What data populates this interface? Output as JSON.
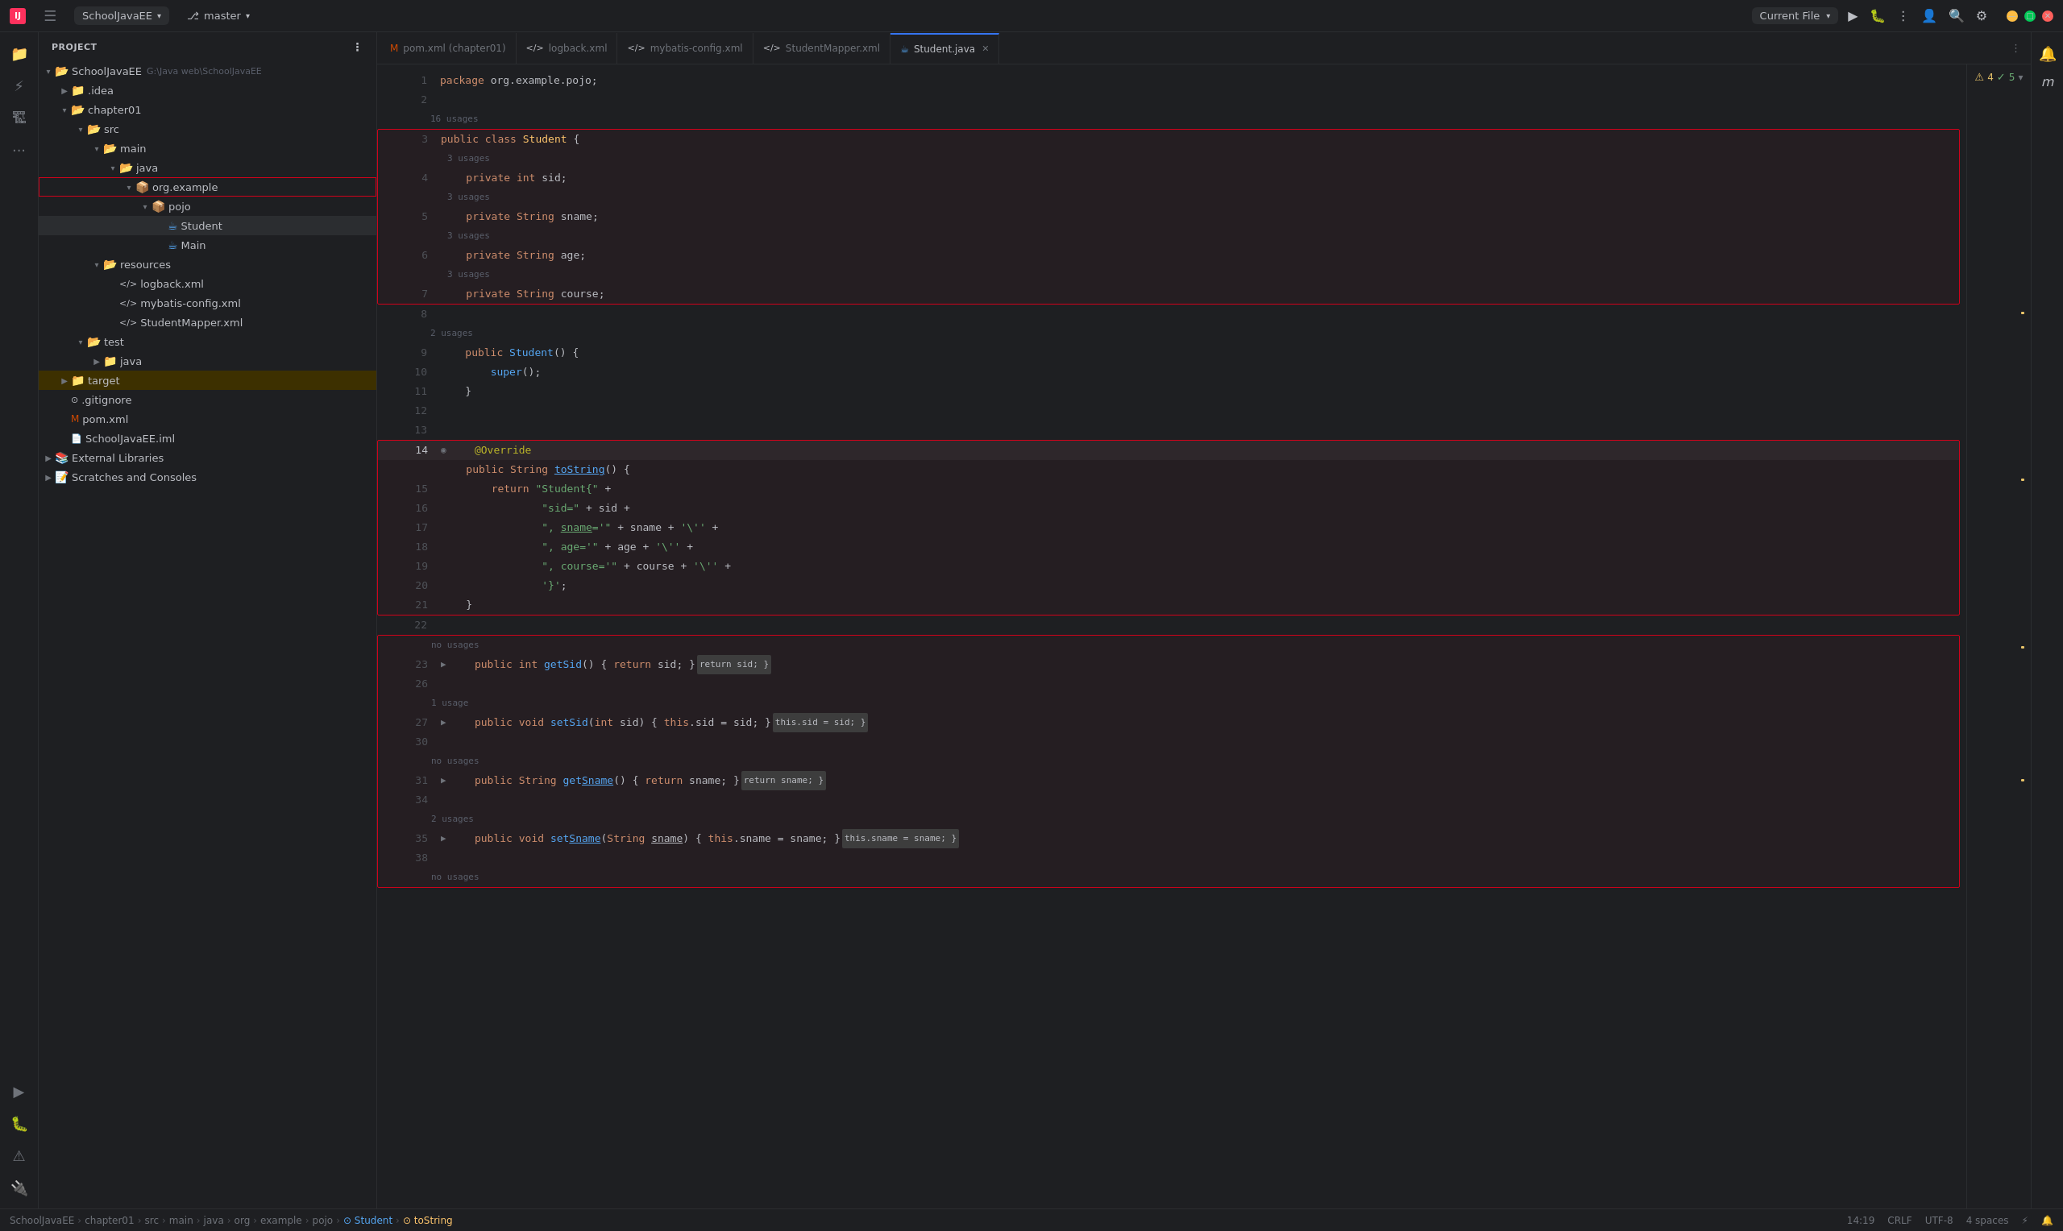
{
  "app": {
    "title": "SchoolJavaEE",
    "branch": "master",
    "logo_text": "IJ"
  },
  "titlebar": {
    "project_label": "SchoolJavaEE",
    "branch_label": "master",
    "run_config": "Current File"
  },
  "sidebar": {
    "header": "Project",
    "tree": [
      {
        "id": "school-root",
        "label": "SchoolJavaEE",
        "path": "G:\\Java web\\SchoolJavaEE",
        "indent": 0,
        "type": "project",
        "expanded": true
      },
      {
        "id": "idea",
        "label": ".idea",
        "indent": 1,
        "type": "folder",
        "expanded": false
      },
      {
        "id": "chapter01",
        "label": "chapter01",
        "indent": 1,
        "type": "folder",
        "expanded": true
      },
      {
        "id": "src",
        "label": "src",
        "indent": 2,
        "type": "folder",
        "expanded": true
      },
      {
        "id": "main",
        "label": "main",
        "indent": 3,
        "type": "folder",
        "expanded": true
      },
      {
        "id": "java",
        "label": "java",
        "indent": 4,
        "type": "folder",
        "expanded": true
      },
      {
        "id": "org-example",
        "label": "org.example",
        "indent": 5,
        "type": "package",
        "expanded": true,
        "highlighted": true
      },
      {
        "id": "pojo",
        "label": "pojo",
        "indent": 6,
        "type": "package",
        "expanded": true
      },
      {
        "id": "student",
        "label": "Student",
        "indent": 7,
        "type": "java",
        "selected": true
      },
      {
        "id": "main-class",
        "label": "Main",
        "indent": 7,
        "type": "java"
      },
      {
        "id": "resources",
        "label": "resources",
        "indent": 3,
        "type": "folder",
        "expanded": true
      },
      {
        "id": "logback-xml",
        "label": "logback.xml",
        "indent": 4,
        "type": "xml"
      },
      {
        "id": "mybatis-config",
        "label": "mybatis-config.xml",
        "indent": 4,
        "type": "xml"
      },
      {
        "id": "student-mapper",
        "label": "StudentMapper.xml",
        "indent": 4,
        "type": "xml"
      },
      {
        "id": "test",
        "label": "test",
        "indent": 2,
        "type": "folder",
        "expanded": true
      },
      {
        "id": "test-java",
        "label": "java",
        "indent": 3,
        "type": "folder",
        "expanded": false
      },
      {
        "id": "target",
        "label": "target",
        "indent": 1,
        "type": "folder",
        "expanded": false,
        "highlighted_row": true
      },
      {
        "id": "gitignore",
        "label": ".gitignore",
        "indent": 1,
        "type": "file"
      },
      {
        "id": "pom-xml",
        "label": "pom.xml",
        "indent": 1,
        "type": "maven"
      },
      {
        "id": "school-iml",
        "label": "SchoolJavaEE.iml",
        "indent": 1,
        "type": "file"
      },
      {
        "id": "ext-libs",
        "label": "External Libraries",
        "indent": 0,
        "type": "libs",
        "expanded": false
      },
      {
        "id": "scratches",
        "label": "Scratches and Consoles",
        "indent": 0,
        "type": "scratches",
        "expanded": false
      }
    ]
  },
  "tabs": [
    {
      "id": "pom",
      "label": "pom.xml (chapter01)",
      "type": "maven",
      "active": false
    },
    {
      "id": "logback",
      "label": "logback.xml",
      "type": "xml",
      "active": false
    },
    {
      "id": "mybatis",
      "label": "mybatis-config.xml",
      "type": "xml",
      "active": false
    },
    {
      "id": "mapper",
      "label": "StudentMapper.xml",
      "type": "xml",
      "active": false
    },
    {
      "id": "student",
      "label": "Student.java",
      "type": "java",
      "active": true
    }
  ],
  "editor": {
    "filename": "Student.java",
    "lines": [
      {
        "num": 1,
        "code": "package org.example.pojo;"
      },
      {
        "num": 2,
        "code": ""
      },
      {
        "num": "",
        "code": "16 usages",
        "type": "usage"
      },
      {
        "num": 3,
        "code": "public class Student {"
      },
      {
        "num": "",
        "code": "3 usages",
        "type": "usage"
      },
      {
        "num": 4,
        "code": "    private int sid;"
      },
      {
        "num": "",
        "code": "3 usages",
        "type": "usage"
      },
      {
        "num": 5,
        "code": "    private String sname;"
      },
      {
        "num": "",
        "code": "3 usages",
        "type": "usage"
      },
      {
        "num": 6,
        "code": "    private String age;"
      },
      {
        "num": "",
        "code": "3 usages",
        "type": "usage"
      },
      {
        "num": 7,
        "code": "    private String course;"
      },
      {
        "num": 8,
        "code": ""
      },
      {
        "num": "",
        "code": "2 usages",
        "type": "usage"
      },
      {
        "num": 9,
        "code": "    public Student() {"
      },
      {
        "num": 10,
        "code": "        super();"
      },
      {
        "num": 11,
        "code": "    }"
      },
      {
        "num": 12,
        "code": ""
      },
      {
        "num": 13,
        "code": ""
      },
      {
        "num": 14,
        "code": "    @Override"
      },
      {
        "num": "",
        "code": "public String toString() {",
        "type": "tostring"
      },
      {
        "num": 15,
        "code": "        return \"Student{\" +"
      },
      {
        "num": 16,
        "code": "                \"sid=\" + sid +"
      },
      {
        "num": 17,
        "code": "                \", sname='\" + sname + '\\'\\'' +"
      },
      {
        "num": 18,
        "code": "                \", age='\" + age + '\\'\\'' +"
      },
      {
        "num": 19,
        "code": "                \", course='\" + course + '\\'\\'' +"
      },
      {
        "num": 20,
        "code": "                '}';"
      },
      {
        "num": 21,
        "code": "    }"
      },
      {
        "num": 22,
        "code": ""
      },
      {
        "num": "",
        "code": "no usages",
        "type": "usage"
      },
      {
        "num": 23,
        "code": "    public int getSid() { return sid; }"
      },
      {
        "num": 26,
        "code": ""
      },
      {
        "num": "",
        "code": "1 usage",
        "type": "usage"
      },
      {
        "num": 27,
        "code": "    public void setSid(int sid) { this.sid = sid; }"
      },
      {
        "num": 30,
        "code": ""
      },
      {
        "num": "",
        "code": "no usages",
        "type": "usage"
      },
      {
        "num": 31,
        "code": "    public String getSname() { return sname; }"
      },
      {
        "num": 34,
        "code": ""
      },
      {
        "num": "",
        "code": "2 usages",
        "type": "usage"
      },
      {
        "num": 35,
        "code": "    public void setSname(String sname) { this.sname = sname; }"
      },
      {
        "num": 38,
        "code": ""
      },
      {
        "num": "",
        "code": "no usages",
        "type": "usage"
      }
    ]
  },
  "statusbar": {
    "breadcrumb": [
      "SchoolJavaEE",
      "chapter01",
      "src",
      "main",
      "java",
      "org",
      "example",
      "pojo",
      "Student",
      "toString"
    ],
    "position": "14:19",
    "line_ending": "CRLF",
    "encoding": "UTF-8",
    "indent": "4 spaces",
    "warnings": "4",
    "ok": "5"
  }
}
